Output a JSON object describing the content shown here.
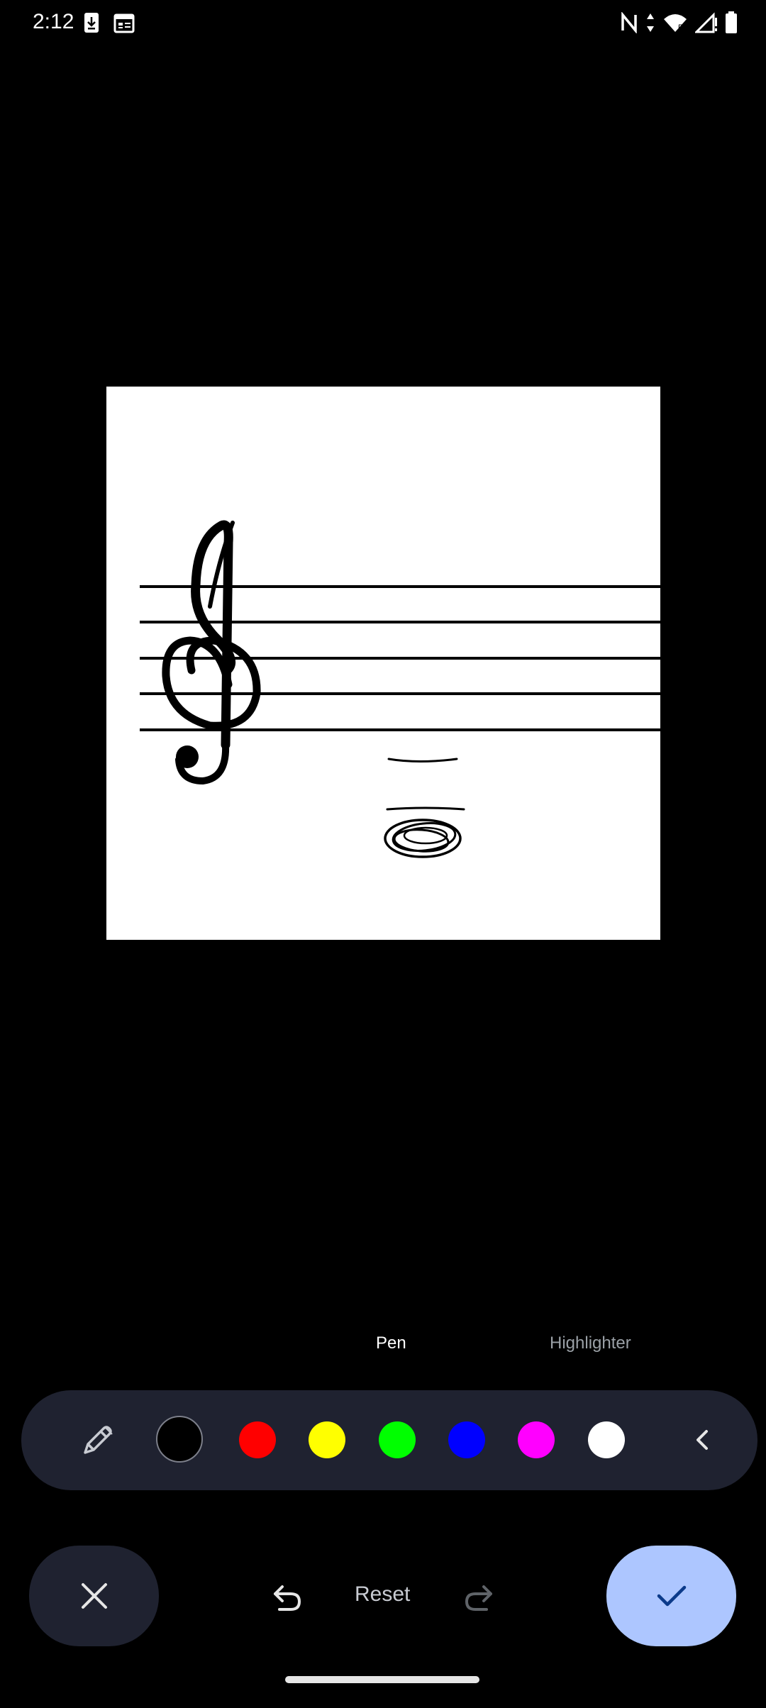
{
  "status_bar": {
    "time": "2:12",
    "left_icons": [
      "download-icon",
      "calendar-icon"
    ],
    "right_icons": [
      "nfc-icon",
      "data-arrows-icon",
      "wifi-icon",
      "signal-icon",
      "battery-icon"
    ]
  },
  "modes": {
    "pen_label": "Pen",
    "highlighter_label": "Highlighter",
    "active": "Pen"
  },
  "palette": {
    "tool_icon": "pen-icon",
    "colors": [
      "#000000",
      "#ff0000",
      "#ffff00",
      "#00ff00",
      "#0000ff",
      "#ff00ff",
      "#ffffff"
    ],
    "selected_color": "#000000",
    "collapse_icon": "chevron-left-icon"
  },
  "actions": {
    "close_icon": "close-icon",
    "undo_icon": "undo-icon",
    "reset_label": "Reset",
    "redo_icon": "redo-icon",
    "confirm_icon": "check-icon"
  },
  "colors": {
    "background": "#000000",
    "toolbar_bg": "#1f2230",
    "confirm_bg": "#adc6ff"
  }
}
